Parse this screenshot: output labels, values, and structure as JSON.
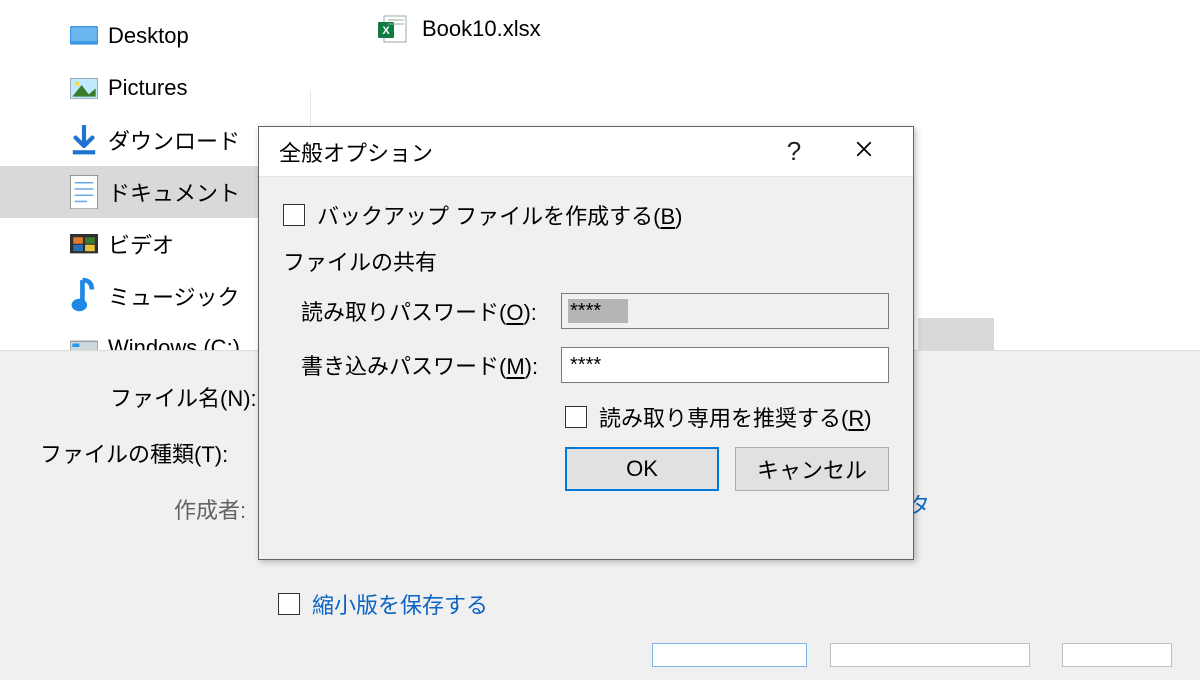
{
  "sidebar": {
    "items": [
      {
        "label": "Desktop"
      },
      {
        "label": "Pictures"
      },
      {
        "label": "ダウンロード"
      },
      {
        "label": "ドキュメント"
      },
      {
        "label": "ビデオ"
      },
      {
        "label": "ミュージック"
      },
      {
        "label": "Windows (C:)"
      }
    ],
    "selected_index": 3
  },
  "file_list": {
    "items": [
      {
        "name": "Book10.xlsx"
      }
    ]
  },
  "save_form": {
    "filename_label": "ファイル名(N):",
    "filetype_label": "ファイルの種類(T):",
    "author_label": "作成者:",
    "thumbnail_label": "縮小版を保存する"
  },
  "dialog": {
    "title": "全般オプション",
    "backup_label_pre": "バックアップ ファイルを作成する(",
    "backup_hotkey": "B",
    "backup_label_post": ")",
    "share_section": "ファイルの共有",
    "read_pw_label_pre": "読み取りパスワード(",
    "read_pw_hotkey": "O",
    "read_pw_label_post": "):",
    "read_pw_value": "****",
    "write_pw_label_pre": "書き込みパスワード(",
    "write_pw_hotkey": "M",
    "write_pw_label_post": "):",
    "write_pw_value": "****",
    "readonly_label_pre": "読み取り専用を推奨する(",
    "readonly_hotkey": "R",
    "readonly_label_post": ")",
    "ok_label": "OK",
    "cancel_label": "キャンセル"
  }
}
